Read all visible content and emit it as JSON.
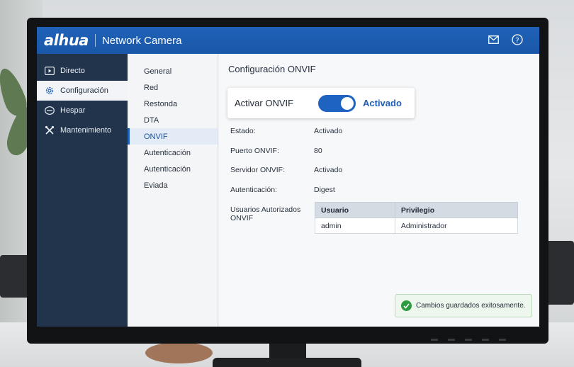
{
  "header": {
    "logo": "alhua",
    "product": "Network Camera",
    "icons": [
      "mail-icon",
      "help-icon"
    ]
  },
  "sidebar": {
    "items": [
      {
        "label": "Directo",
        "icon": "play-icon"
      },
      {
        "label": "Configuración",
        "icon": "gear-icon",
        "active": true
      },
      {
        "label": "Hespar",
        "icon": "hdd-icon"
      },
      {
        "label": "Mantenimiento",
        "icon": "tools-icon"
      }
    ]
  },
  "submenu": {
    "items": [
      {
        "label": "General"
      },
      {
        "label": "Red"
      },
      {
        "label": "Restonda"
      },
      {
        "label": "DTA"
      },
      {
        "label": "ONVIF",
        "active": true
      },
      {
        "label": "Autenticación"
      },
      {
        "label": "Autenticación"
      },
      {
        "label": "Eviada"
      }
    ]
  },
  "main": {
    "title": "Configuración ONVIF",
    "toggle": {
      "label": "Activar ONVIF",
      "state": "Activado",
      "on": true
    },
    "fields": [
      {
        "label": "Estado:",
        "value": "Activado"
      },
      {
        "label": "Puerto ONVIF:",
        "value": "80"
      },
      {
        "label": "Servidor ONVIF:",
        "value": "Activado"
      },
      {
        "label": "Autenticación:",
        "value": "Digest"
      }
    ],
    "users_label": "Usuarios Autorizados ONVIF",
    "users_table": {
      "headers": [
        "Usuario",
        "Privilegio"
      ],
      "rows": [
        [
          "admin",
          "Administrador"
        ]
      ]
    }
  },
  "toast": {
    "message": "Cambios guardados exitosamente.",
    "icon": "check-circle-icon"
  },
  "colors": {
    "brand_blue": "#1f62b8",
    "sidebar_dark": "#22344c",
    "success_green": "#2d9b3f"
  }
}
